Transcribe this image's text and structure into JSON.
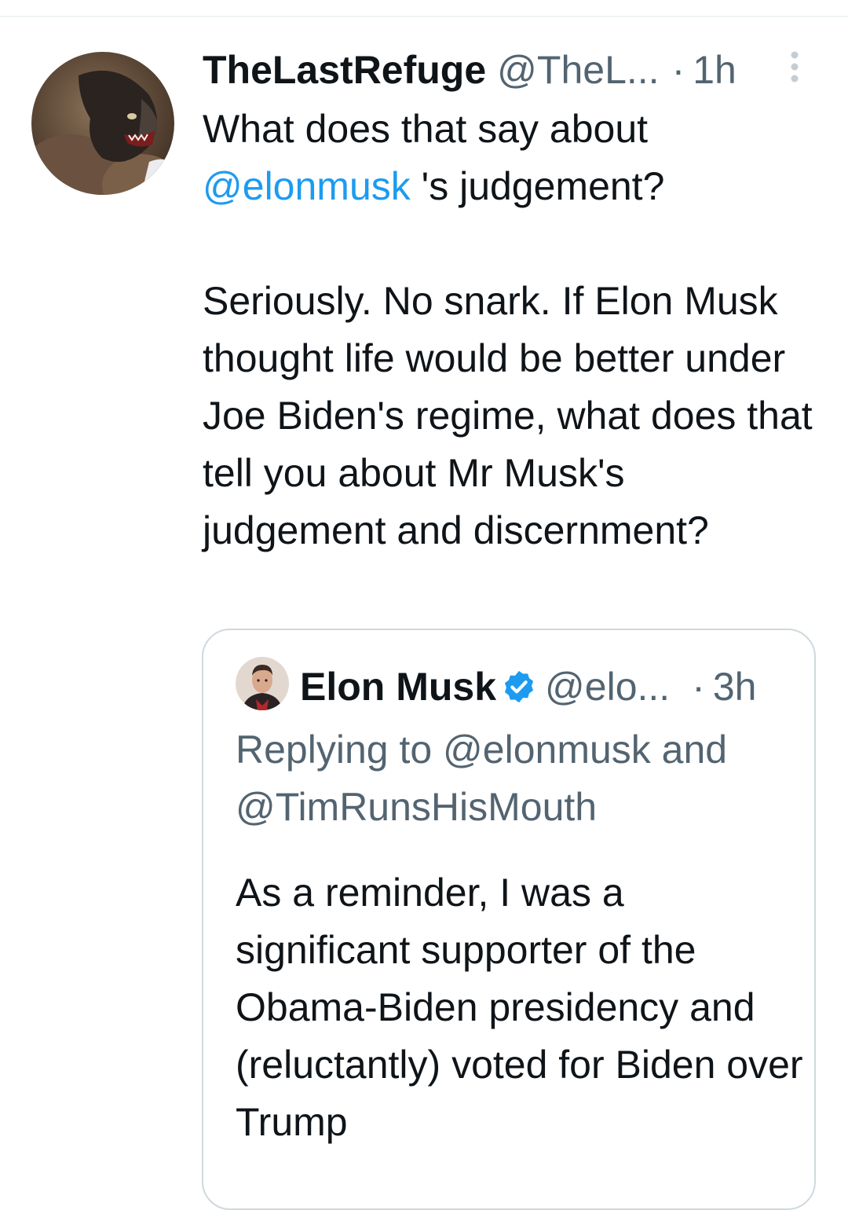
{
  "tweet": {
    "display_name": "TheLastRefuge",
    "handle": "@TheL...",
    "separator": "·",
    "time": "1h",
    "body": {
      "line1": "What does that say about",
      "mention": "@elonmusk",
      "after_mention": " 's judgement?",
      "paragraph2": "Seriously.  No snark.  If Elon Musk thought life would be better under Joe Biden's regime, what does that tell you about Mr Musk's judgement and discernment?"
    }
  },
  "quoted_tweet": {
    "display_name": "Elon Musk",
    "verified": true,
    "handle": "@elo...",
    "separator": "·",
    "time": "3h",
    "replying_to": "Replying to @elonmusk and @TimRunsHisMouth",
    "body": "As a reminder, I was a significant supporter of the Obama-Biden presidency and (reluctantly) voted for Biden over Trump"
  },
  "colors": {
    "text_primary": "#0f1419",
    "text_secondary": "#536471",
    "link": "#1d9bf0",
    "border": "#cfd9de"
  },
  "icons": {
    "more": "more-vertical-icon",
    "verified": "verified-badge-icon"
  }
}
